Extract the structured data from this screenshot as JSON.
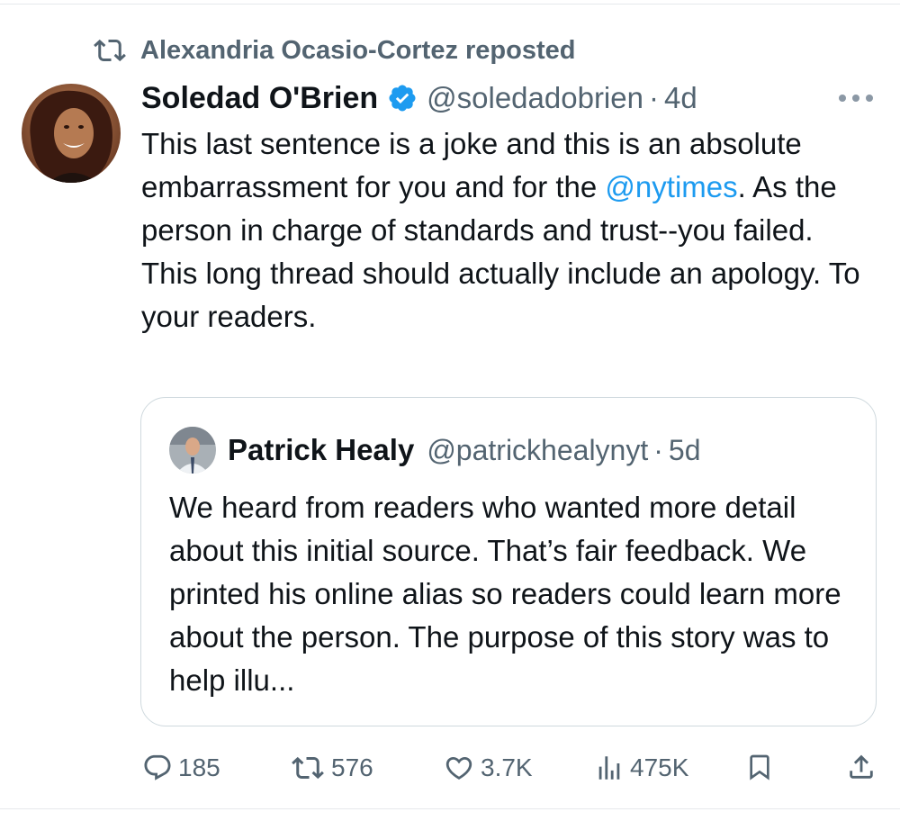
{
  "repost": {
    "label": "Alexandria Ocasio-Cortez reposted",
    "icon": "repost-icon"
  },
  "tweet": {
    "display_name": "Soledad O'Brien",
    "handle": "@soledadobrien",
    "separator": "·",
    "time": "4d",
    "verified_icon": "verified-badge-icon",
    "more_icon": "more-icon",
    "text_part1": "This last sentence is a joke and this is an absolute embarrassment for you and for the ",
    "mention": "@nytimes",
    "text_part2": ". As the person in charge of standards and trust--you failed. This long thread should actually include an apology.  To your readers."
  },
  "quote": {
    "display_name": "Patrick Healy",
    "handle": "@patrickhealynyt",
    "separator": "·",
    "time": "5d",
    "text": "We heard from readers who wanted more detail about this initial source. That’s fair feedback. We printed his online alias so readers could learn more about the person. The purpose of this story was to help illu..."
  },
  "actions": {
    "replies": "185",
    "reposts": "576",
    "likes": "3.7K",
    "views": "475K",
    "icons": [
      "reply-icon",
      "repost-icon",
      "like-icon",
      "views-icon",
      "bookmark-icon",
      "share-icon"
    ]
  },
  "colors": {
    "text": "#0f1419",
    "secondary": "#536471",
    "link": "#1d9bf0",
    "border": "#cfd9de"
  }
}
